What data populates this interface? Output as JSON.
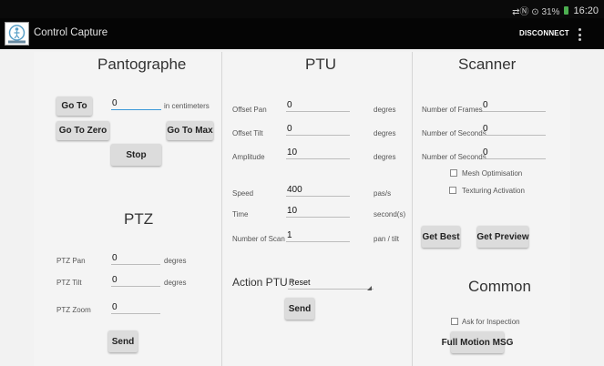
{
  "status_bar": {
    "indicators": "⇄Ⓝ ⊙ 31%",
    "time": "16:20"
  },
  "app_bar": {
    "title": "Control Capture",
    "disconnect_label": "DISCONNECT"
  },
  "pantographe": {
    "title": "Pantographe",
    "goto_label": "Go To",
    "goto_value": "0",
    "goto_unit": "in centimeters",
    "goto_zero_label": "Go To Zero",
    "goto_max_label": "Go To Max",
    "stop_label": "Stop"
  },
  "ptz": {
    "title": "PTZ",
    "pan_label": "PTZ Pan",
    "pan_value": "0",
    "pan_unit": "degres",
    "tilt_label": "PTZ Tilt",
    "tilt_value": "0",
    "tilt_unit": "degres",
    "zoom_label": "PTZ Zoom",
    "zoom_value": "0",
    "send_label": "Send"
  },
  "ptu": {
    "title": "PTU",
    "offset_pan_label": "Offset Pan",
    "offset_pan_value": "0",
    "offset_pan_unit": "degres",
    "offset_tilt_label": "Offset Tilt",
    "offset_tilt_value": "0",
    "offset_tilt_unit": "degres",
    "amplitude_label": "Amplitude",
    "amplitude_value": "10",
    "amplitude_unit": "degres",
    "speed_label": "Speed",
    "speed_value": "400",
    "speed_unit": "pas/s",
    "time_label": "Time",
    "time_value": "10",
    "time_unit": "second(s)",
    "nscan_label": "Number of Scan",
    "nscan_value": "1",
    "nscan_unit": "pan / tilt",
    "action_label": "Action PTU :",
    "action_value": "Reset",
    "send_label": "Send"
  },
  "scanner": {
    "title": "Scanner",
    "frames_label": "Number of Frames",
    "frames_value": "0",
    "seconds1_label": "Number of Seconds",
    "seconds1_value": "0",
    "seconds2_label": "Number of Seconds",
    "seconds2_value": "0",
    "mesh_label": "Mesh Optimisation",
    "texturing_label": "Texturing Activation",
    "get_best_label": "Get Best",
    "get_preview_label": "Get Preview"
  },
  "common": {
    "title": "Common",
    "ask_label": "Ask for Inspection",
    "full_motion_label": "Full Motion MSG"
  },
  "colors": {
    "app_bar": "#050505",
    "panel_bg": "#f4f4f4",
    "accent_underline": "#3a97d8",
    "button_bg": "#dcdcdc"
  }
}
